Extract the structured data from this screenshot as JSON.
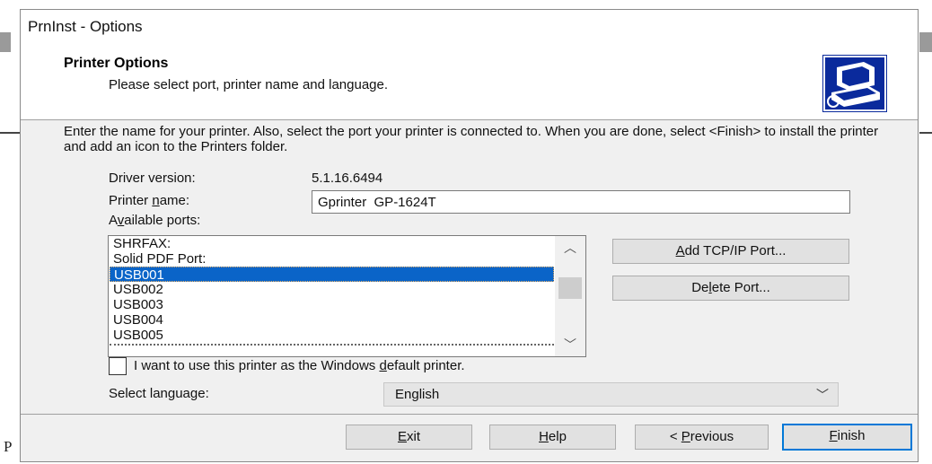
{
  "background": {
    "text_fragment": "P"
  },
  "dialog": {
    "title": "PrnInst - Options",
    "header": {
      "title": "Printer Options",
      "subtitle": "Please select port, printer name and language."
    },
    "intro": "Enter the name for your printer. Also, select the port your printer is connected to. When you are done, select <Finish> to install the printer and add an icon to the Printers folder.",
    "driver_version_label": "Driver version:",
    "driver_version_value": "5.1.16.6494",
    "printer_name_label": {
      "pre": "Printer ",
      "accel": "n",
      "post": "ame:"
    },
    "printer_name_value": "Gprinter  GP-1624T",
    "available_ports_label": {
      "pre": "A",
      "accel": "v",
      "post": "ailable ports:"
    },
    "ports": [
      {
        "label": "SHRFAX:",
        "selected": false
      },
      {
        "label": "Solid PDF Port:",
        "selected": false
      },
      {
        "label": "USB001",
        "selected": true
      },
      {
        "label": "USB002",
        "selected": false
      },
      {
        "label": "USB003",
        "selected": false
      },
      {
        "label": "USB004",
        "selected": false
      },
      {
        "label": "USB005",
        "selected": false
      }
    ],
    "add_tcp_button": {
      "pre": "",
      "accel": "A",
      "post": "dd TCP/IP Port..."
    },
    "delete_port_button": {
      "pre": "De",
      "accel": "l",
      "post": "ete Port..."
    },
    "default_checkbox": {
      "checked": false,
      "label": {
        "pre": "I want to use this printer as the Windows ",
        "accel": "d",
        "post": "efault printer."
      }
    },
    "language_label": "Select language:",
    "language_value": "English",
    "buttons": {
      "exit": {
        "pre": "",
        "accel": "E",
        "post": "xit"
      },
      "help": {
        "pre": "",
        "accel": "H",
        "post": "elp"
      },
      "previous": {
        "pre": "< ",
        "accel": "P",
        "post": "revious"
      },
      "finish": {
        "pre": "",
        "accel": "F",
        "post": "inish"
      }
    }
  },
  "colors": {
    "selection": "#0a64c8",
    "default_button_border": "#0078d7",
    "dialog_bg": "#f0f0f0"
  },
  "icons": [
    "printer-wizard-icon",
    "scroll-up-icon",
    "scroll-down-icon",
    "dropdown-chevron-icon"
  ]
}
